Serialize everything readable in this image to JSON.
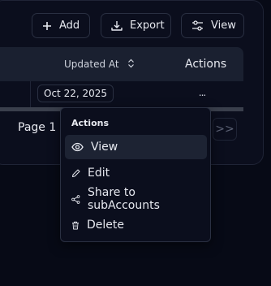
{
  "toolbar": {
    "add_label": "Add",
    "export_label": "Export",
    "view_label": "View"
  },
  "table": {
    "headers": {
      "updated_at": "Updated At",
      "actions": "Actions"
    },
    "rows": [
      {
        "updated_at": "Oct 22, 2025",
        "actions": "..."
      }
    ]
  },
  "pagination": {
    "page_text": "Page 1 o",
    "last_label": ">>"
  },
  "context_menu": {
    "title": "Actions",
    "items": [
      {
        "label": "View",
        "icon": "eye-icon"
      },
      {
        "label": "Edit",
        "icon": "pencil-icon"
      },
      {
        "label": "Share to subAccounts",
        "icon": "share-icon"
      },
      {
        "label": "Delete",
        "icon": "trash-icon"
      }
    ]
  },
  "colors": {
    "background": "#070a16",
    "card": "#0b0e1d",
    "table_header": "#1a2030",
    "menu_hover": "#1d2333",
    "border": "#2a3042"
  }
}
